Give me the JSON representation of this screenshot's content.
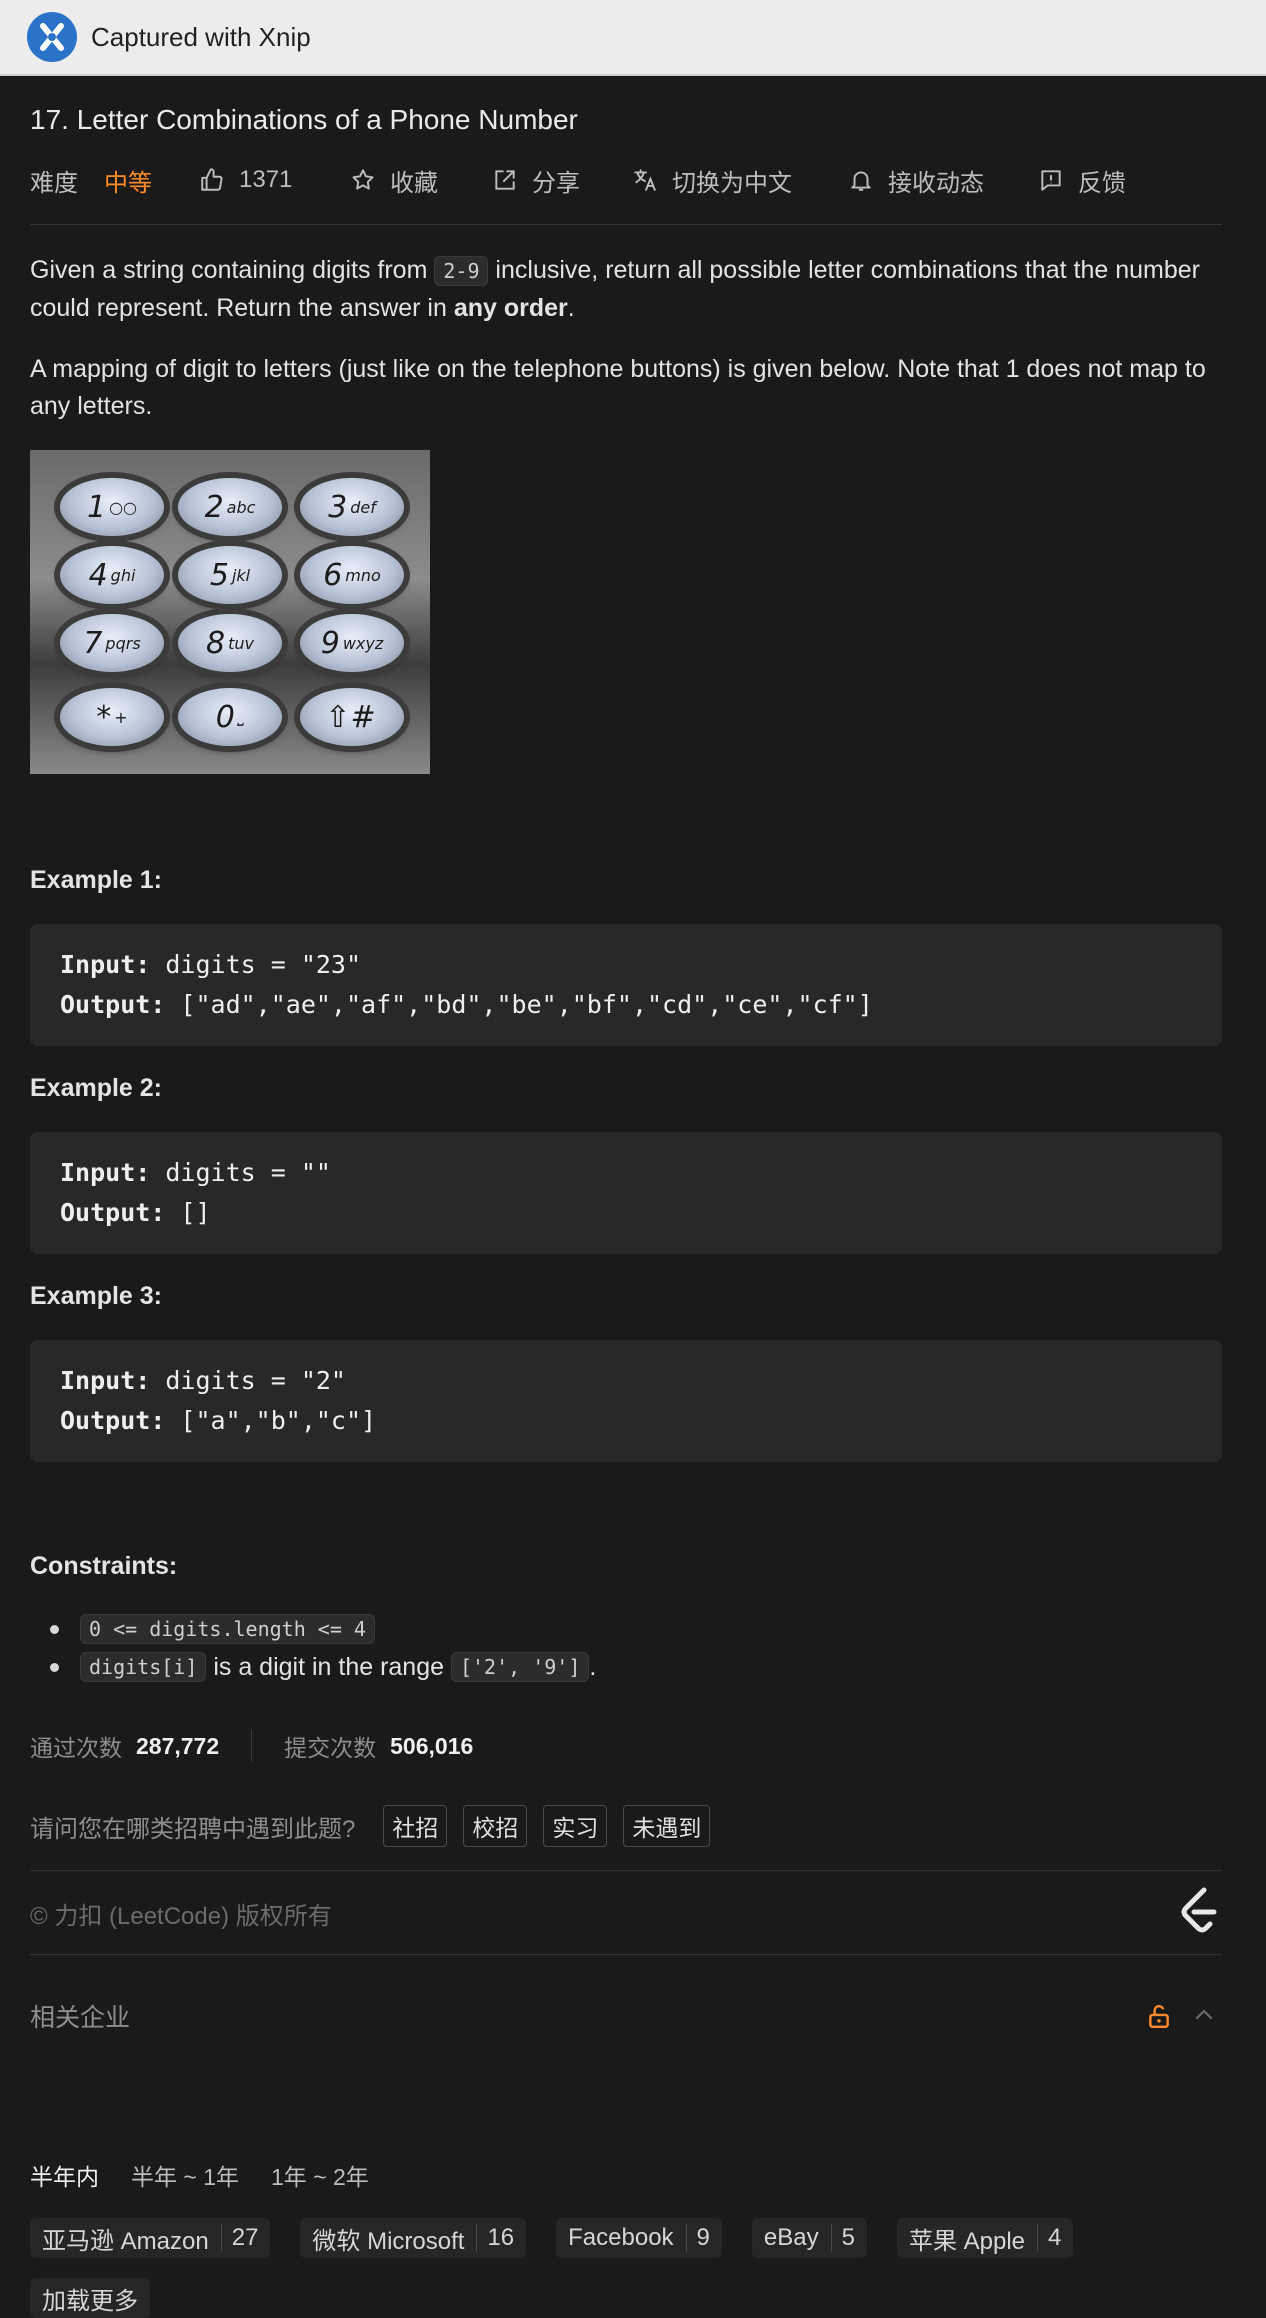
{
  "window": {
    "title": "Captured with Xnip"
  },
  "problem": {
    "title": "17. Letter Combinations of a Phone Number",
    "difficulty_label": "难度",
    "difficulty_value": "中等",
    "likes": "1371",
    "actions": {
      "favorite": "收藏",
      "share": "分享",
      "switch_lang": "切换为中文",
      "subscribe": "接收动态",
      "feedback": "反馈"
    }
  },
  "description": {
    "p1_a": "Given a string containing digits from ",
    "p1_code": "2-9",
    "p1_b": " inclusive, return all possible letter combinations that the number could represent. Return the answer in ",
    "p1_bold": "any order",
    "p1_c": ".",
    "p2": "A mapping of digit to letters (just like on the telephone buttons) is given below. Note that 1 does not map to any letters."
  },
  "keypad": [
    {
      "num": "1",
      "sub": "○○"
    },
    {
      "num": "2",
      "sub": "abc"
    },
    {
      "num": "3",
      "sub": "def"
    },
    {
      "num": "4",
      "sub": "ghi"
    },
    {
      "num": "5",
      "sub": "jkl"
    },
    {
      "num": "6",
      "sub": "mno"
    },
    {
      "num": "7",
      "sub": "pqrs"
    },
    {
      "num": "8",
      "sub": "tuv"
    },
    {
      "num": "9",
      "sub": "wxyz"
    },
    {
      "num": "*",
      "sub": "+"
    },
    {
      "num": "0",
      "sub": "⎵"
    },
    {
      "num": "⇧#",
      "sub": ""
    }
  ],
  "examples": [
    {
      "heading": "Example 1:",
      "input_label": "Input:",
      "input": " digits = \"23\"",
      "output_label": "Output:",
      "output": " [\"ad\",\"ae\",\"af\",\"bd\",\"be\",\"bf\",\"cd\",\"ce\",\"cf\"]"
    },
    {
      "heading": "Example 2:",
      "input_label": "Input:",
      "input": " digits = \"\"",
      "output_label": "Output:",
      "output": " []"
    },
    {
      "heading": "Example 3:",
      "input_label": "Input:",
      "input": " digits = \"2\"",
      "output_label": "Output:",
      "output": " [\"a\",\"b\",\"c\"]"
    }
  ],
  "constraints": {
    "heading": "Constraints:",
    "c1_code": "0 <= digits.length <= 4",
    "c2_code": "digits[i]",
    "c2_text": " is a digit in the range ",
    "c2_code2": "['2', '9']",
    "c2_end": "."
  },
  "stats": {
    "accepted_label": "通过次数",
    "accepted": "287,772",
    "submissions_label": "提交次数",
    "submissions": "506,016"
  },
  "survey": {
    "question": "请问您在哪类招聘中遇到此题?",
    "options": [
      "社招",
      "校招",
      "实习",
      "未遇到"
    ]
  },
  "footer": {
    "copyright": "© 力扣 (LeetCode) 版权所有"
  },
  "companies": {
    "title": "相关企业",
    "time_tabs": [
      "半年内",
      "半年 ~ 1年",
      "1年 ~ 2年"
    ],
    "tags": [
      {
        "name": "亚马逊 Amazon",
        "count": "27"
      },
      {
        "name": "微软 Microsoft",
        "count": "16"
      },
      {
        "name": "Facebook",
        "count": "9"
      },
      {
        "name": "eBay",
        "count": "5"
      },
      {
        "name": "苹果 Apple",
        "count": "4"
      }
    ],
    "load_more": "加载更多"
  },
  "colors": {
    "accent_orange": "#ff8a2a",
    "background": "#1a1a1a",
    "code_bg": "#282828"
  }
}
